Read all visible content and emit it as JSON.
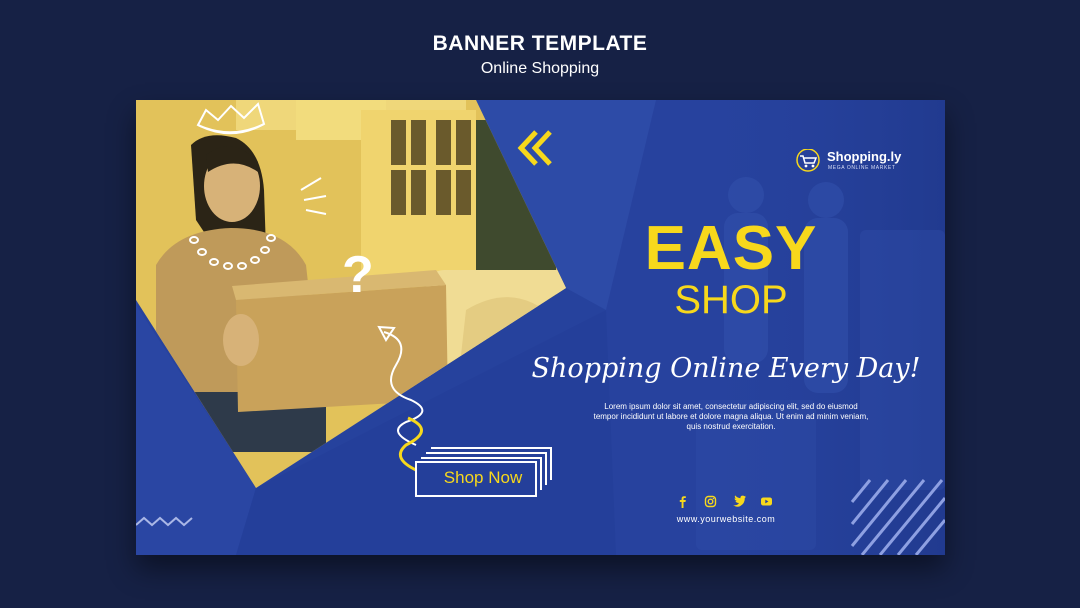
{
  "header": {
    "title": "BANNER TEMPLATE",
    "subtitle": "Online Shopping"
  },
  "banner": {
    "logo": {
      "name": "Shopping.ly",
      "tagline": "MEGA ONLINE MARKET"
    },
    "headline_line1": "EASY",
    "headline_line2": "SHOP",
    "script": "Shopping Online Every Day!",
    "body": "Lorem ipsum dolor sit amet, consectetur adipiscing elit, sed do eiusmod tempor incididunt ut labore et dolore magna aliqua. Ut enim ad minim veniam, quis nostrud exercitation.",
    "cta_label": "Shop Now",
    "social_icons": [
      "facebook-icon",
      "instagram-icon",
      "twitter-icon",
      "youtube-icon"
    ],
    "website": "www.yourwebsite.com"
  },
  "colors": {
    "page_bg": "#162145",
    "banner_blue": "#27429e",
    "accent_yellow": "#f7d81c",
    "photo_tint": "#e2c25a"
  }
}
